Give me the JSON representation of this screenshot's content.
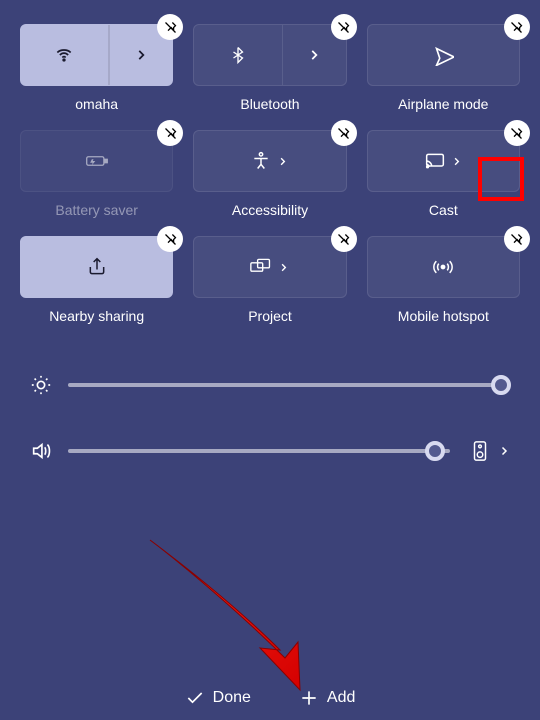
{
  "tiles": [
    {
      "id": "wifi",
      "label": "omaha",
      "icon": "wifi-icon",
      "active": true,
      "split": true,
      "disabled": false
    },
    {
      "id": "bluetooth",
      "label": "Bluetooth",
      "icon": "bluetooth-icon",
      "active": false,
      "split": true,
      "disabled": false
    },
    {
      "id": "airplane",
      "label": "Airplane mode",
      "icon": "airplane-icon",
      "active": false,
      "split": false,
      "disabled": false
    },
    {
      "id": "battery",
      "label": "Battery saver",
      "icon": "battery-icon",
      "active": false,
      "split": false,
      "disabled": true
    },
    {
      "id": "accessibility",
      "label": "Accessibility",
      "icon": "accessibility-icon",
      "active": false,
      "split": true,
      "disabled": false
    },
    {
      "id": "cast",
      "label": "Cast",
      "icon": "cast-icon",
      "active": false,
      "split": true,
      "disabled": false
    },
    {
      "id": "nearby",
      "label": "Nearby sharing",
      "icon": "share-icon",
      "active": true,
      "split": false,
      "disabled": false
    },
    {
      "id": "project",
      "label": "Project",
      "icon": "project-icon",
      "active": false,
      "split": true,
      "disabled": false
    },
    {
      "id": "hotspot",
      "label": "Mobile hotspot",
      "icon": "hotspot-icon",
      "active": false,
      "split": false,
      "disabled": false
    }
  ],
  "sliders": {
    "brightness": {
      "value_pct": 98
    },
    "volume": {
      "value_pct": 96
    }
  },
  "footer": {
    "done": "Done",
    "add": "Add"
  },
  "annotations": {
    "highlight_tile": "cast-pin",
    "arrow_target": "add-button"
  },
  "colors": {
    "bg": "#3c4278",
    "tile_active": "#b9bde0",
    "highlight": "#ff0000"
  }
}
